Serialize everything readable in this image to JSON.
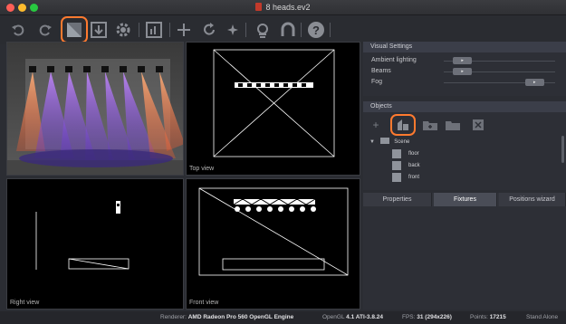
{
  "window": {
    "title": "8 heads.ev2"
  },
  "toolbar": {
    "icons": [
      "undo-icon",
      "redo-icon",
      "select-icon",
      "import-icon",
      "settings-icon",
      "chart-icon",
      "move-icon",
      "rotate-icon",
      "pin-icon",
      "dmx-icon",
      "magnet-icon",
      "help-icon"
    ]
  },
  "views": {
    "perspective_label": "",
    "top_label": "Top view",
    "right_label": "Right view",
    "front_label": "Front view"
  },
  "visual_settings": {
    "title": "Visual Settings",
    "rows": [
      {
        "label": "Ambient lighting",
        "value": 0.1
      },
      {
        "label": "Beams",
        "value": 0.1
      },
      {
        "label": "Fog",
        "value": 0.88
      }
    ]
  },
  "objects": {
    "title": "Objects",
    "scene_label": "Scene",
    "items": [
      "floor",
      "back",
      "front"
    ]
  },
  "tabs": {
    "items": [
      "Properties",
      "Fixtures",
      "Positions wizard"
    ],
    "active": 1
  },
  "status": {
    "renderer_label": "Renderer:",
    "renderer": "AMD Radeon Pro 560 OpenGL Engine",
    "opengl_label": "OpenGL",
    "opengl": "4.1 ATI-3.8.24",
    "fps_label": "FPS:",
    "fps": "31 (294x226)",
    "points_label": "Points:",
    "points": "17215",
    "mode": "Stand Alone"
  },
  "colors": {
    "highlight": "#ff7a2f",
    "beam_purple": "#8a4cff",
    "beam_orange": "#ff8a3a"
  }
}
